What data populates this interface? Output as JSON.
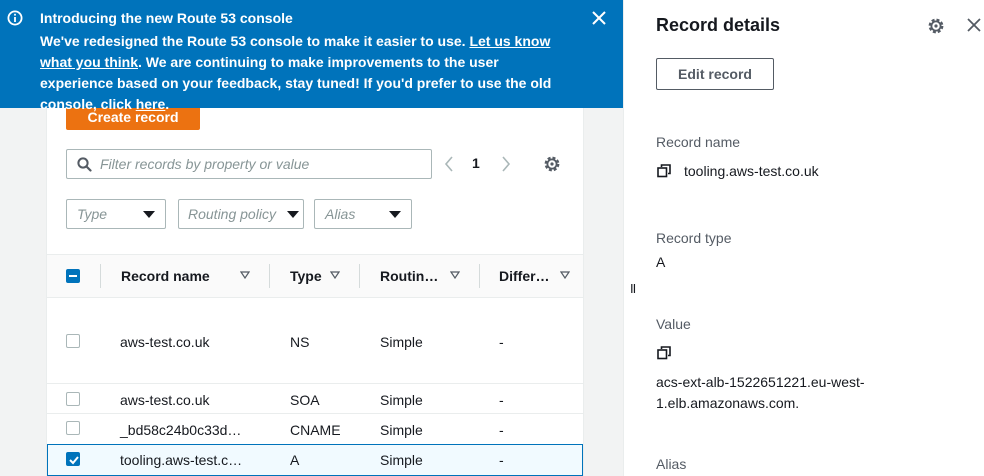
{
  "banner": {
    "title": "Introducing the new Route 53 console",
    "body_pre": "We've redesigned the Route 53 console to make it easier to use. ",
    "link_feedback": "Let us know what you think",
    "body_mid": ". We are continuing to make improvements to the user experience based on your feedback, stay tuned! If you'd prefer to use the old console, click ",
    "link_here": "here",
    "body_end": ".",
    "icons": {
      "info": "info-icon",
      "close": "close-icon"
    }
  },
  "toolbar": {
    "create_label": "Create record",
    "search_placeholder": "Filter records by property or value",
    "page": "1"
  },
  "filters": {
    "type_placeholder": "Type",
    "routing_placeholder": "Routing policy",
    "alias_placeholder": "Alias"
  },
  "table": {
    "columns": [
      "Record name",
      "Type",
      "Routin…",
      "Differ…"
    ],
    "rows": [
      {
        "name": "aws-test.co.uk",
        "type": "NS",
        "routing": "Simple",
        "differ": "-",
        "checked": false
      },
      {
        "name": "aws-test.co.uk",
        "type": "SOA",
        "routing": "Simple",
        "differ": "-",
        "checked": false
      },
      {
        "name": "_bd58c24b0c33d…",
        "type": "CNAME",
        "routing": "Simple",
        "differ": "-",
        "checked": false
      },
      {
        "name": "tooling.aws-test.c…",
        "type": "A",
        "routing": "Simple",
        "differ": "-",
        "checked": true
      }
    ]
  },
  "details": {
    "title": "Record details",
    "edit_label": "Edit record",
    "record_name_label": "Record name",
    "record_name": "tooling.aws-test.co.uk",
    "record_type_label": "Record type",
    "record_type": "A",
    "value_label": "Value",
    "value_line1": "acs-ext-alb-1522651221.eu-west-",
    "value_line2": "1.elb.amazonaws.com.",
    "alias_label": "Alias",
    "splitter_glyph": "II"
  },
  "colors": {
    "banner": "#0073bb",
    "primary_button": "#ec7211",
    "selection": "#0073bb"
  }
}
